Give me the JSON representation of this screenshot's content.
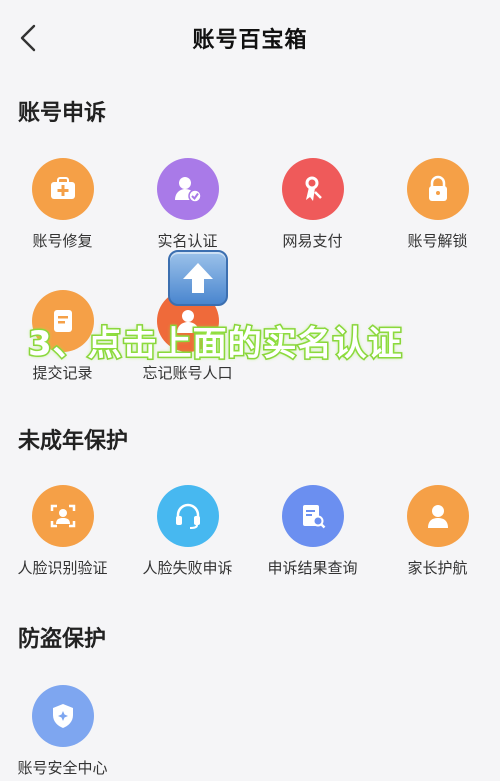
{
  "header": {
    "title": "账号百宝箱"
  },
  "sections": [
    {
      "title": "账号申诉"
    },
    {
      "title": "未成年保护"
    },
    {
      "title": "防盗保护"
    }
  ],
  "appeal_items": [
    {
      "label": "账号修复",
      "color": "#f5a047",
      "icon": "medkit-icon"
    },
    {
      "label": "实名认证",
      "color": "#a97ae8",
      "icon": "user-verified-icon"
    },
    {
      "label": "网易支付",
      "color": "#ef5a5a",
      "icon": "pay-icon"
    },
    {
      "label": "账号解锁",
      "color": "#f5a047",
      "icon": "lock-icon"
    },
    {
      "label": "提交记录",
      "color": "#f5a047",
      "icon": "record-icon"
    },
    {
      "label": "忘记账号人口",
      "color": "#ef6a3a",
      "icon": "person-icon"
    }
  ],
  "minor_items": [
    {
      "label": "人脸识别验证",
      "color": "#f5a047",
      "icon": "face-scan-icon"
    },
    {
      "label": "人脸失败申诉",
      "color": "#47b8f0",
      "icon": "headset-icon"
    },
    {
      "label": "申诉结果查询",
      "color": "#6b8ff0",
      "icon": "doc-search-icon"
    },
    {
      "label": "家长护航",
      "color": "#f5a047",
      "icon": "parent-icon"
    }
  ],
  "security_items": [
    {
      "label": "账号安全中心",
      "color": "#7ea6f0",
      "icon": "shield-icon"
    }
  ],
  "overlay": {
    "caption": "3、点击上面的实名认证",
    "arrow_icon": "up-arrow-icon"
  }
}
